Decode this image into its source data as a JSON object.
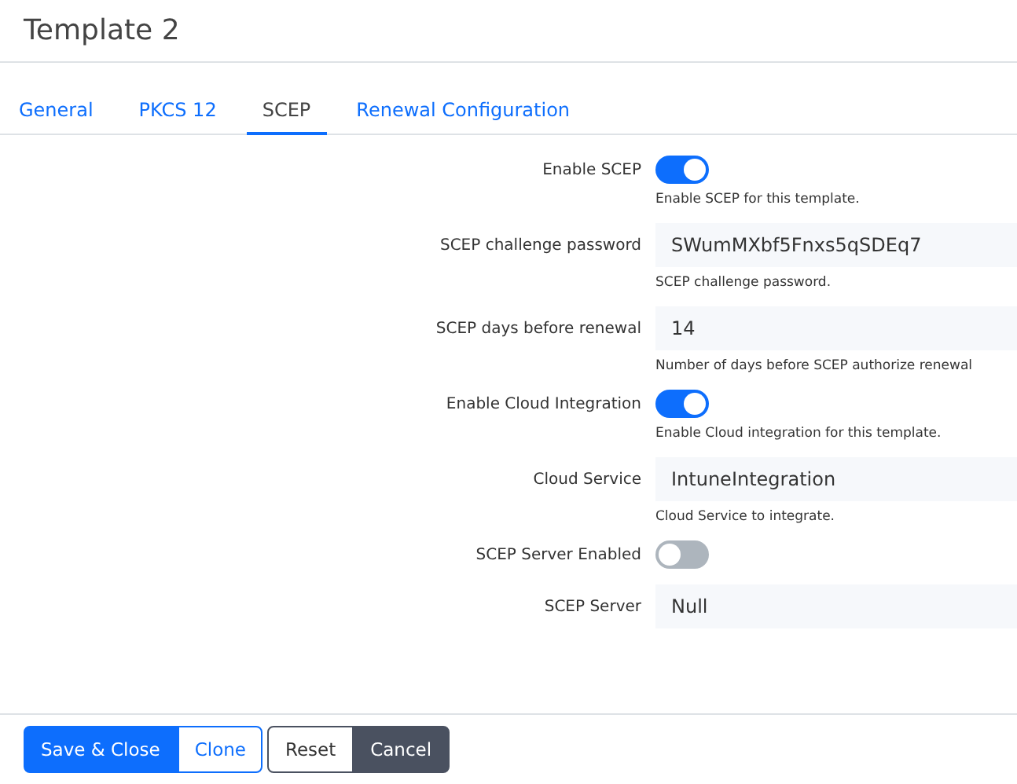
{
  "title": "Template 2",
  "tabs": [
    {
      "label": "General",
      "selected": false
    },
    {
      "label": "PKCS 12",
      "selected": false
    },
    {
      "label": "SCEP",
      "selected": true
    },
    {
      "label": "Renewal Configuration",
      "selected": false
    }
  ],
  "fields": [
    {
      "kind": "toggle",
      "label": "Enable SCEP",
      "on": true,
      "help": "Enable SCEP for this template."
    },
    {
      "kind": "text",
      "label": "SCEP challenge password",
      "value": "SWumMXbf5Fnxs5qSDEq7",
      "help": "SCEP challenge password."
    },
    {
      "kind": "text",
      "label": "SCEP days before renewal",
      "value": "14",
      "help": "Number of days before SCEP authorize renewal"
    },
    {
      "kind": "toggle",
      "label": "Enable Cloud Integration",
      "on": true,
      "help": "Enable Cloud integration for this template."
    },
    {
      "kind": "text",
      "label": "Cloud Service",
      "value": "IntuneIntegration",
      "help": "Cloud Service to integrate."
    },
    {
      "kind": "toggle",
      "label": "SCEP Server Enabled",
      "on": false
    },
    {
      "kind": "text",
      "label": "SCEP Server",
      "value": "Null"
    }
  ],
  "buttons": [
    {
      "label": "Save & Close",
      "kind": "primary"
    },
    {
      "label": "Clone",
      "kind": "outline-primary"
    },
    {
      "label": "Reset",
      "kind": "outline-dark"
    },
    {
      "label": "Cancel",
      "kind": "dark"
    }
  ]
}
